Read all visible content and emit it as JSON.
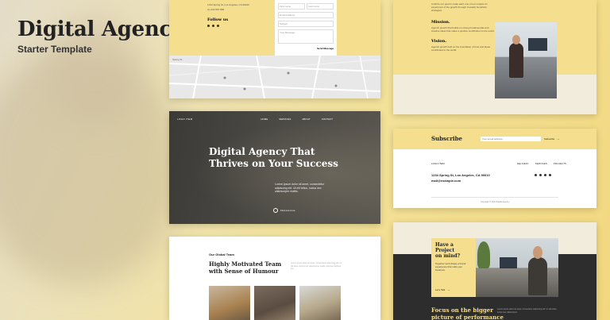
{
  "hero": {
    "title": "Digital Agency",
    "subtitle": "Starter Template"
  },
  "contact_card": {
    "address": "1234 Spring St, Los Angeles, CA 90010",
    "phone": "(1) 234 567 890",
    "follow_label": "Follow us",
    "form_fields": [
      "First name",
      "Last name",
      "Email Address",
      "Subject",
      "Your Message"
    ],
    "send_label": "Send Message",
    "map_label": "Spring St"
  },
  "mission_card": {
    "intro": "It will be our goal to make each one of our outputs an experience of the growth through mutually beneficial strategies.",
    "mission_title": "Mission.",
    "mission_text": "Agentic growth that builds on strong fundamentals and creative ideas that make a positive contribution to the world.",
    "vision_title": "Vision.",
    "vision_text": "Agentic growth built on the foundation of trust and ideas contributed to the world."
  },
  "main_hero_card": {
    "logo": "LOGO ITEM",
    "nav": [
      "HOME",
      "SERVICES",
      "ABOUT",
      "CONTACT"
    ],
    "headline_1": "Digital Agency That",
    "headline_2": "Thrives on Your Success",
    "body": "Lorem ipsum dolor sit amet, consectetur adipiscing elit. Ut elit tellus, luctus nec ullamcorper mattis.",
    "cta": "Find out more"
  },
  "subscribe_card": {
    "title": "Subscribe",
    "email_placeholder": "Your email address",
    "button": "Subscribe",
    "logo": "LOGO ITEM",
    "nav": [
      "DELIVERY",
      "SERVICES",
      "PROJECTS"
    ],
    "address": "1234 Spring St, Los Angeles, CA 90010",
    "email": "mail@example.com",
    "copyright": "Copyright © 2024 Digital Agency"
  },
  "team_card": {
    "label": "Our Global Team",
    "heading_1": "Highly Motivated Team",
    "heading_2": "with Sense of Humour",
    "desc": "Lorem ipsum dolor sit amet, consectetur adipiscing elit. Ut elit tellus, luctus nec ullamcorper mattis, pulvinar dapibus leo."
  },
  "project_card": {
    "title_1": "Have a Project",
    "title_2": "on mind?",
    "text": "Together we'll shape a brand experience that suits your business.",
    "cta": "Let's Talk",
    "focus_1": "Focus on the bigger",
    "focus_2": "picture of performance",
    "desc": "Lorem ipsum dolor sit amet, consectetur adipiscing elit. Ut elit tellus, luctus nec ullamcorper."
  },
  "colors": {
    "accent": "#f5df8f",
    "dark": "#2b2b2b",
    "background": "#f3e29a"
  }
}
